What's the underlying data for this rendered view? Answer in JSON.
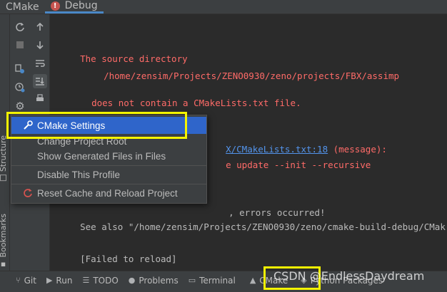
{
  "tabs": [
    {
      "label": "CMake",
      "active": false
    },
    {
      "label": "Debug",
      "active": true,
      "badge": "!"
    }
  ],
  "side_labels": {
    "structure": "Structure",
    "bookmarks": "Bookmarks"
  },
  "console": {
    "lines": [
      {
        "text": "The source directory",
        "kind": "error"
      },
      {
        "text": "/home/zensim/Projects/ZENO0930/zeno/projects/FBX/assimp",
        "kind": "error"
      },
      {
        "text": "does not contain a CMakeLists.txt file.",
        "kind": "error"
      },
      {
        "text": "X/CMakeLists.txt:18",
        "kind": "link"
      },
      {
        "text": " (message):",
        "kind": "error"
      },
      {
        "text": "e update --init --recursive",
        "kind": "error"
      },
      {
        "text": ", errors occurred!",
        "kind": "normal"
      },
      {
        "text": "See also \"/home/zensim/Projects/ZENO0930/zeno/cmake-build-debug/CMak",
        "kind": "normal"
      },
      {
        "text": "[Failed to reload]",
        "kind": "normal"
      }
    ]
  },
  "context_menu": {
    "items": [
      {
        "label": "CMake Settings",
        "icon": "wrench-icon",
        "selected": true
      },
      {
        "label": "Change Project Root",
        "icon": "",
        "selected": false
      },
      {
        "label": "Show Generated Files in Files",
        "icon": "",
        "selected": false
      },
      {
        "label": "Disable This Profile",
        "icon": "",
        "selected": false
      },
      {
        "label": "Reset Cache and Reload Project",
        "icon": "reload-icon",
        "selected": false
      }
    ]
  },
  "bottom_tools": [
    {
      "label": "Git",
      "icon": "git-branch-icon"
    },
    {
      "label": "Run",
      "icon": "play-icon"
    },
    {
      "label": "TODO",
      "icon": "list-icon"
    },
    {
      "label": "Problems",
      "icon": "warning-circle-icon"
    },
    {
      "label": "Terminal",
      "icon": "terminal-icon"
    },
    {
      "label": "CMake",
      "icon": "cmake-icon"
    },
    {
      "label": "Python Packages",
      "icon": "packages-icon"
    }
  ],
  "watermark": "CSDN @EndlessDaydream",
  "colors": {
    "error_text": "#ff6b68",
    "link_text": "#5394ec",
    "selection": "#2f65ca",
    "highlight": "#f4f400",
    "background": "#2b2b2b",
    "panel": "#3c3f41"
  }
}
